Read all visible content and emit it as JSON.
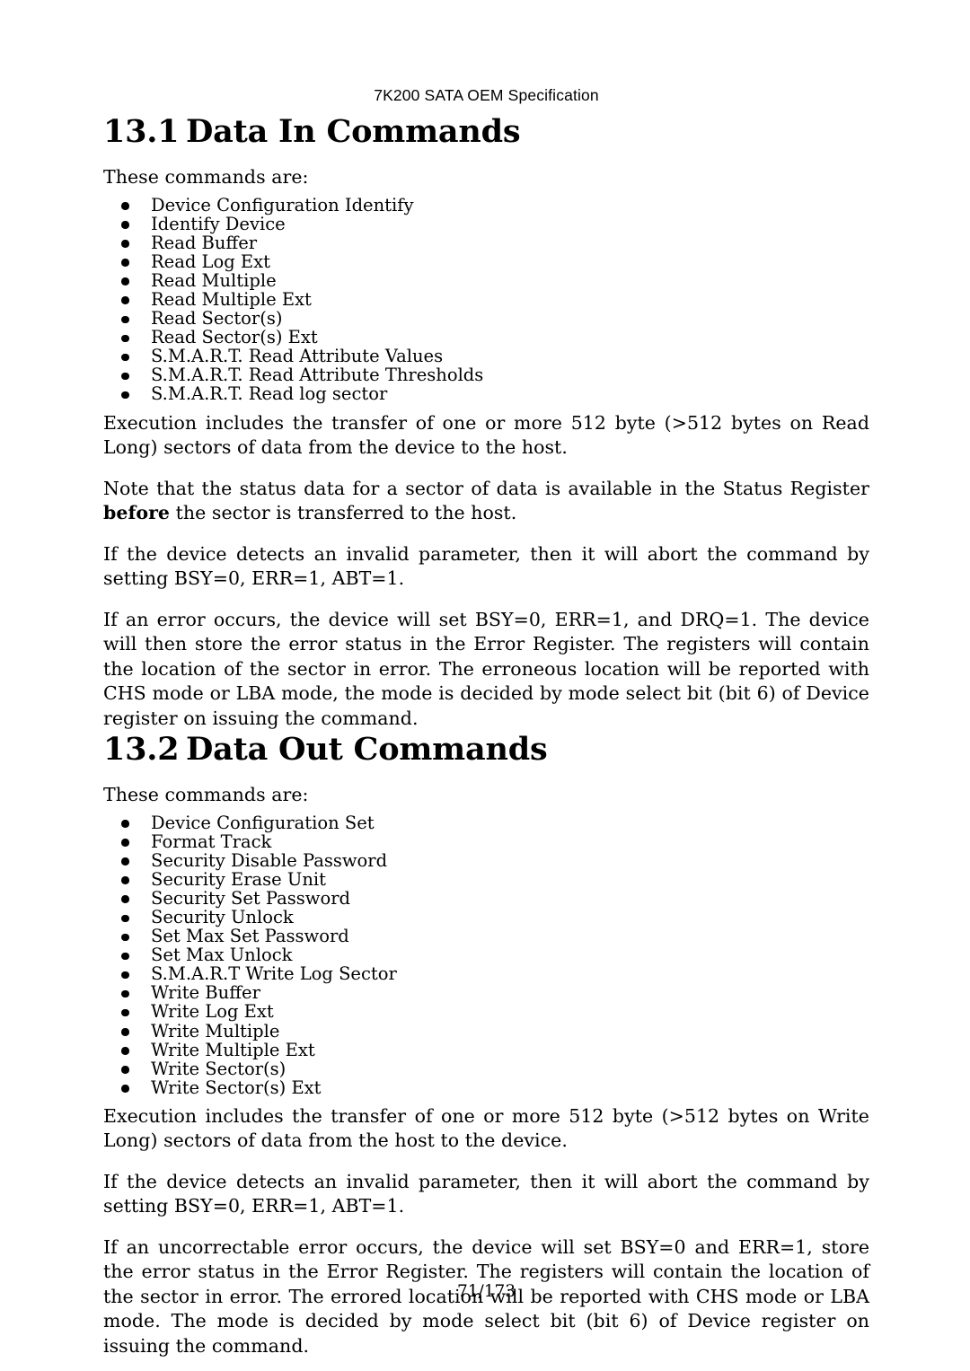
{
  "document": {
    "running_header": "7K200 SATA OEM Specification",
    "footer": "71/173"
  },
  "sections": [
    {
      "number": "13.1",
      "title": "Data In Commands",
      "lead_in": "These commands are:",
      "commands": [
        "Device Configuration Identify",
        "Identify Device",
        "Read Buffer",
        "Read Log Ext",
        "Read Multiple",
        "Read Multiple Ext",
        "Read Sector(s)",
        "Read Sector(s) Ext",
        "S.M.A.R.T. Read Attribute Values",
        "S.M.A.R.T. Read Attribute Thresholds",
        "S.M.A.R.T. Read log sector"
      ],
      "paragraphs": {
        "execution": "Execution includes the transfer of one or more 512 byte (>512 bytes on Read Long) sectors of data from the device to the host.",
        "note_before": "Note that the status data for a sector of data is available in the Status Register ",
        "note_emph": "before",
        "note_after": " the sector is transferred to the host.",
        "invalid_parameter": "If the device detects an invalid parameter, then it will abort the command by setting BSY=0, ERR=1, ABT=1.",
        "error_occurs": "If an error occurs, the device will set BSY=0, ERR=1, and DRQ=1. The device will then store the error status in the Error Register. The registers will contain the location of the sector in error. The erroneous location will be reported with CHS mode or LBA mode, the mode is decided by mode select bit (bit 6) of Device register on issuing the command."
      }
    },
    {
      "number": "13.2",
      "title": "Data Out Commands",
      "lead_in": "These commands are:",
      "commands": [
        "Device Configuration Set",
        "Format Track",
        "Security Disable Password",
        "Security Erase Unit",
        "Security Set Password",
        "Security Unlock",
        "Set Max Set Password",
        "Set Max Unlock",
        "S.M.A.R.T Write Log Sector",
        "Write Buffer",
        "Write Log Ext",
        "Write Multiple",
        "Write Multiple Ext",
        "Write Sector(s)",
        "Write Sector(s) Ext"
      ],
      "paragraphs": {
        "execution": "Execution includes the transfer of one or more 512 byte (>512 bytes on Write Long) sectors of data from the host to the device.",
        "invalid_parameter": "If the device detects an invalid parameter, then it will abort the command by setting BSY=0, ERR=1, ABT=1.",
        "uncorrectable_error": "If an uncorrectable error occurs, the device will set BSY=0 and ERR=1, store the error status in the Error Register. The registers will contain the location of the sector in error. The errored location will be reported with CHS mode or LBA mode. The mode is decided by mode select bit (bit 6) of Device register on issuing the command."
      }
    }
  ]
}
